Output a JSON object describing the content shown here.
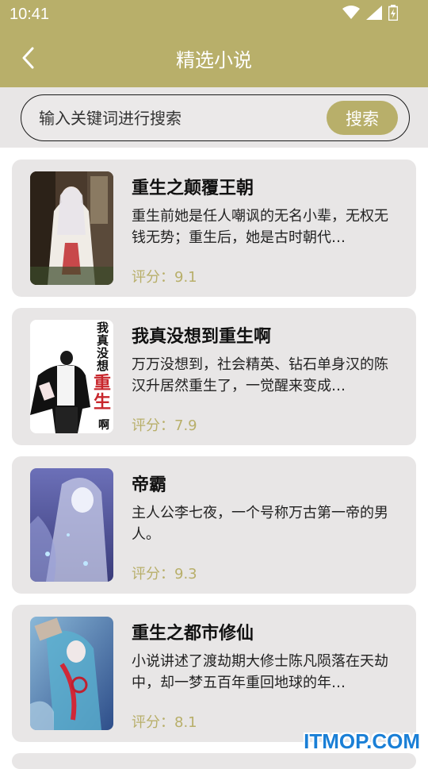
{
  "status_bar": {
    "time": "10:41"
  },
  "header": {
    "title": "精选小说",
    "back_icon": "chevron-left-icon"
  },
  "search": {
    "placeholder": "输入关键词进行搜索",
    "button_label": "搜索"
  },
  "books": [
    {
      "title": "重生之颠覆王朝",
      "description": "重生前她是任人嘲讽的无名小辈，无权无钱无势；重生后，她是古时朝代…",
      "rating": "评分：9.1"
    },
    {
      "title": "我真没想到重生啊",
      "description": "万万没想到，社会精英、钻石单身汉的陈汉升居然重生了，一觉醒来变成…",
      "rating": "评分：7.9",
      "cover_text": [
        "我真没想",
        "重生",
        "啊"
      ]
    },
    {
      "title": "帝霸",
      "description": "主人公李七夜，一个号称万古第一帝的男人。",
      "rating": "评分：9.3"
    },
    {
      "title": "重生之都市修仙",
      "description": "小说讲述了渡劫期大修士陈凡陨落在天劫中，却一梦五百年重回地球的年…",
      "rating": "评分：8.1"
    }
  ],
  "watermark": "ITMOP.COM",
  "colors": {
    "accent": "#b8af6a",
    "card_bg": "#e8e6e6",
    "watermark": "#1a7fd6"
  }
}
